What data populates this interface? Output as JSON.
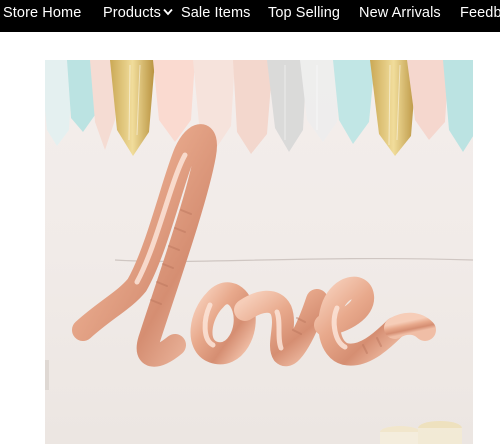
{
  "nav": {
    "items": [
      {
        "id": "store-home",
        "label": "Store Home"
      },
      {
        "id": "products",
        "label": "Products",
        "has_dropdown": true,
        "icon": "chevron-down-icon"
      },
      {
        "id": "sale-items",
        "label": "Sale Items"
      },
      {
        "id": "top-selling",
        "label": "Top Selling"
      },
      {
        "id": "new-arrivals",
        "label": "New Arrivals"
      },
      {
        "id": "feedback",
        "label": "Feedb"
      }
    ]
  },
  "product_image": {
    "subject": "rose gold script love foil balloon with tassel garland",
    "balloon_text": "love"
  },
  "colors": {
    "nav_background": "#000000",
    "nav_text": "#ffffff",
    "balloon_rose_gold": "#e8a98c"
  }
}
